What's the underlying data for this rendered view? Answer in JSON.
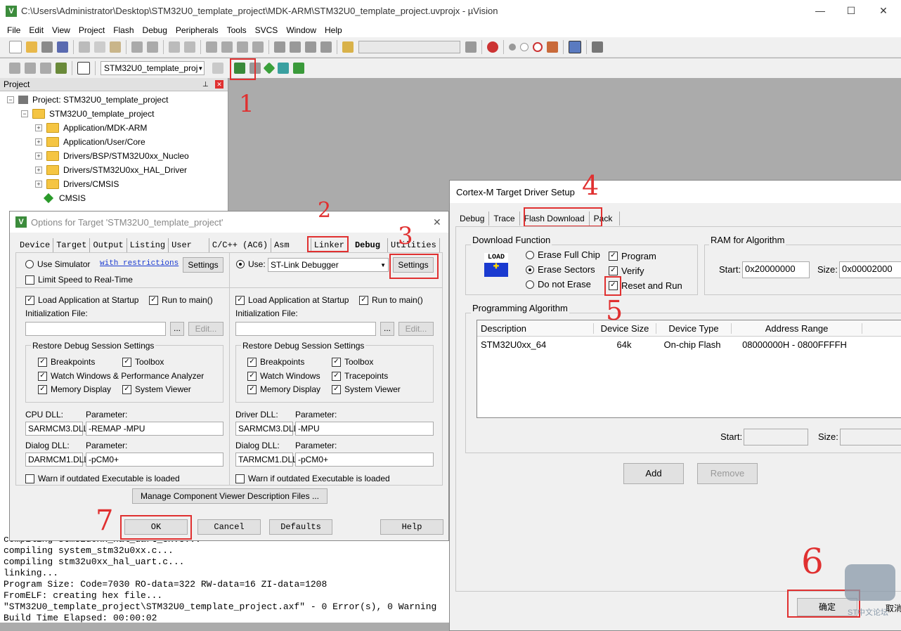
{
  "window": {
    "title": "C:\\Users\\Administrator\\Desktop\\STM32U0_template_project\\MDK-ARM\\STM32U0_template_project.uvprojx - µVision"
  },
  "menu": [
    "File",
    "Edit",
    "View",
    "Project",
    "Flash",
    "Debug",
    "Peripherals",
    "Tools",
    "SVCS",
    "Window",
    "Help"
  ],
  "toolbar2": {
    "target_select": "STM32U0_template_proj"
  },
  "project": {
    "title": "Project",
    "root": "Project: STM32U0_template_project",
    "target": "STM32U0_template_project",
    "groups": [
      "Application/MDK-ARM",
      "Application/User/Core",
      "Drivers/BSP/STM32U0xx_Nucleo",
      "Drivers/STM32U0xx_HAL_Driver",
      "Drivers/CMSIS"
    ],
    "cmsis": "CMSIS"
  },
  "build_output": {
    "lines": [
      "compiling stm32u0xx_hal_uart_ex.c...",
      "compiling system_stm32u0xx.c...",
      "compiling stm32u0xx_hal_uart.c...",
      "linking...",
      "Program Size: Code=7030 RO-data=322 RW-data=16 ZI-data=1208",
      "FromELF: creating hex file...",
      "\"STM32U0_template_project\\STM32U0_template_project.axf\" - 0 Error(s), 0 Warning",
      "Build Time Elapsed:  00:00:02"
    ],
    "side_label": "Bu"
  },
  "options": {
    "title": "Options for Target 'STM32U0_template_project'",
    "tabs": [
      "Device",
      "Target",
      "Output",
      "Listing",
      "User",
      "C/C++ (AC6)",
      "Asm",
      "Linker",
      "Debug",
      "Utilities"
    ],
    "left": {
      "use_simulator": "Use Simulator",
      "with_restrictions": "with restrictions",
      "settings": "Settings",
      "limit_speed": "Limit Speed to Real-Time",
      "load_app": "Load Application at Startup",
      "run_main": "Run to main()",
      "init_file": "Initialization File:",
      "browse": "...",
      "edit": "Edit...",
      "restore": "Restore Debug Session Settings",
      "breakpoints": "Breakpoints",
      "toolbox": "Toolbox",
      "watch": "Watch Windows & Performance Analyzer",
      "memory": "Memory Display",
      "sysviewer": "System Viewer",
      "cpu_dll_label": "CPU DLL:",
      "param_label": "Parameter:",
      "cpu_dll": "SARMCM3.DLL",
      "cpu_param": "-REMAP -MPU",
      "dialog_dll_label": "Dialog DLL:",
      "dialog_dll": "DARMCM1.DLL",
      "dialog_param": "-pCM0+",
      "warn": "Warn if outdated Executable is loaded"
    },
    "right": {
      "use": "Use:",
      "debugger": "ST-Link Debugger",
      "settings": "Settings",
      "load_app": "Load Application at Startup",
      "run_main": "Run to main()",
      "init_file": "Initialization File:",
      "browse": "...",
      "edit": "Edit...",
      "restore": "Restore Debug Session Settings",
      "breakpoints": "Breakpoints",
      "toolbox": "Toolbox",
      "watch": "Watch Windows",
      "tracepoints": "Tracepoints",
      "memory": "Memory Display",
      "sysviewer": "System Viewer",
      "driver_dll_label": "Driver DLL:",
      "param_label": "Parameter:",
      "driver_dll": "SARMCM3.DLL",
      "driver_param": "-MPU",
      "dialog_dll_label": "Dialog DLL:",
      "dialog_dll": "TARMCM1.DLL",
      "dialog_param": "-pCM0+",
      "warn": "Warn if outdated Executable is loaded"
    },
    "manage": "Manage Component Viewer Description Files ...",
    "buttons": {
      "ok": "OK",
      "cancel": "Cancel",
      "defaults": "Defaults",
      "help": "Help"
    }
  },
  "cortex": {
    "title": "Cortex-M Target Driver Setup",
    "tabs": [
      "Debug",
      "Trace",
      "Flash Download",
      "Pack"
    ],
    "download_function": "Download Function",
    "load_icon": "LOAD",
    "erase_full": "Erase Full Chip",
    "erase_sectors": "Erase Sectors",
    "do_not_erase": "Do not Erase",
    "program": "Program",
    "verify": "Verify",
    "reset_run": "Reset and Run",
    "ram_title": "RAM for Algorithm",
    "start_label": "Start:",
    "start_value": "0x20000000",
    "size_label": "Size:",
    "size_value": "0x00002000",
    "prog_algo": "Programming Algorithm",
    "columns": [
      "Description",
      "Device Size",
      "Device Type",
      "Address Range"
    ],
    "rows": [
      [
        "STM32U0xx_64",
        "64k",
        "On-chip Flash",
        "08000000H - 0800FFFFH"
      ]
    ],
    "algo_start": "Start:",
    "algo_size": "Size:",
    "add": "Add",
    "remove": "Remove",
    "ok": "确定",
    "cancel": "取消"
  },
  "annotations": [
    "1",
    "2",
    "3",
    "4",
    "5",
    "6",
    "7"
  ],
  "watermark": "ST中文论坛",
  "colors": {
    "accent_red": "#e03030",
    "dialog_bg": "#f0f0f0",
    "workspace": "#ababab"
  }
}
